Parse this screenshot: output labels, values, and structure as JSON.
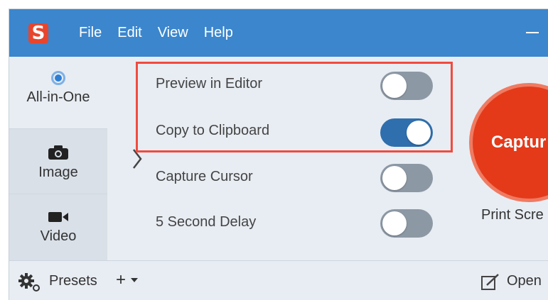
{
  "app": {
    "logo_letter": "S",
    "logo_color": "#e8452c",
    "titlebar_color": "#3b86cd"
  },
  "menu": [
    {
      "label": "File"
    },
    {
      "label": "Edit"
    },
    {
      "label": "View"
    },
    {
      "label": "Help"
    }
  ],
  "tabs": [
    {
      "label": "All-in-One",
      "icon": "radio-selected-icon",
      "selected": true
    },
    {
      "label": "Image",
      "icon": "camera-icon",
      "selected": false
    },
    {
      "label": "Video",
      "icon": "video-camera-icon",
      "selected": false
    }
  ],
  "options": [
    {
      "label": "Preview in Editor",
      "on": false
    },
    {
      "label": "Copy to Clipboard",
      "on": true
    },
    {
      "label": "Capture Cursor",
      "on": false
    },
    {
      "label": "5 Second Delay",
      "on": false
    }
  ],
  "highlight_color": "#f04b3f",
  "capture": {
    "label": "Captur",
    "sublabel": "Print Scre",
    "color": "#e43a1a"
  },
  "footer": {
    "presets_label": "Presets",
    "add_label": "+",
    "open_label": "Open"
  }
}
